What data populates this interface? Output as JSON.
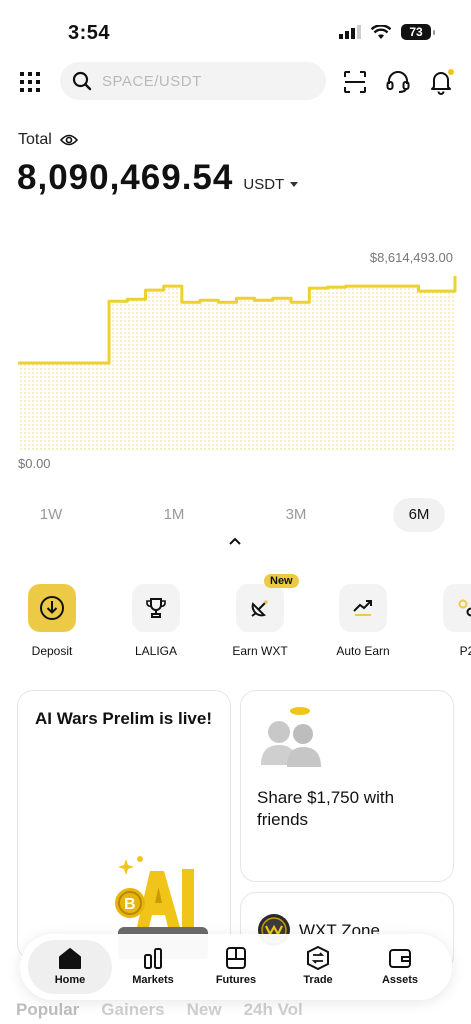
{
  "status_bar": {
    "time": "3:54",
    "battery": "73"
  },
  "header": {
    "search_placeholder": "SPACE/USDT"
  },
  "total": {
    "label": "Total",
    "amount": "8,090,469.54",
    "currency": "USDT"
  },
  "chart_data": {
    "type": "area",
    "max_label": "$8,614,493.00",
    "min_label": "$0.00",
    "values": [
      4.3,
      4.3,
      4.3,
      4.3,
      4.3,
      7.35,
      7.45,
      7.9,
      8.1,
      7.3,
      7.4,
      7.3,
      7.5,
      7.4,
      7.5,
      7.3,
      8.0,
      8.05,
      8.1,
      8.1,
      8.1,
      8.1,
      7.85,
      7.85,
      8.6
    ],
    "color": "#ecd12f"
  },
  "range_tabs": [
    {
      "label": "1W",
      "active": false
    },
    {
      "label": "1M",
      "active": false
    },
    {
      "label": "3M",
      "active": false
    },
    {
      "label": "6M",
      "active": true
    }
  ],
  "quick_actions": [
    {
      "label": "Deposit",
      "icon": "download-icon"
    },
    {
      "label": "LALIGA",
      "icon": "trophy-icon"
    },
    {
      "label": "Earn WXT",
      "icon": "satellite-icon",
      "badge": "New"
    },
    {
      "label": "Auto Earn",
      "icon": "trend-icon"
    },
    {
      "label": "P2",
      "icon": "p2p-icon"
    }
  ],
  "cards": {
    "ai_title": "AI Wars Prelim is live!",
    "share_title": "Share $1,750 with friends",
    "wxt_title": "WXT Zone"
  },
  "market_tabs": [
    "Popular",
    "Gainers",
    "New",
    "24h Vol"
  ],
  "nav": [
    {
      "label": "Home",
      "active": true
    },
    {
      "label": "Markets",
      "active": false
    },
    {
      "label": "Futures",
      "active": false
    },
    {
      "label": "Trade",
      "active": false
    },
    {
      "label": "Assets",
      "active": false
    }
  ]
}
